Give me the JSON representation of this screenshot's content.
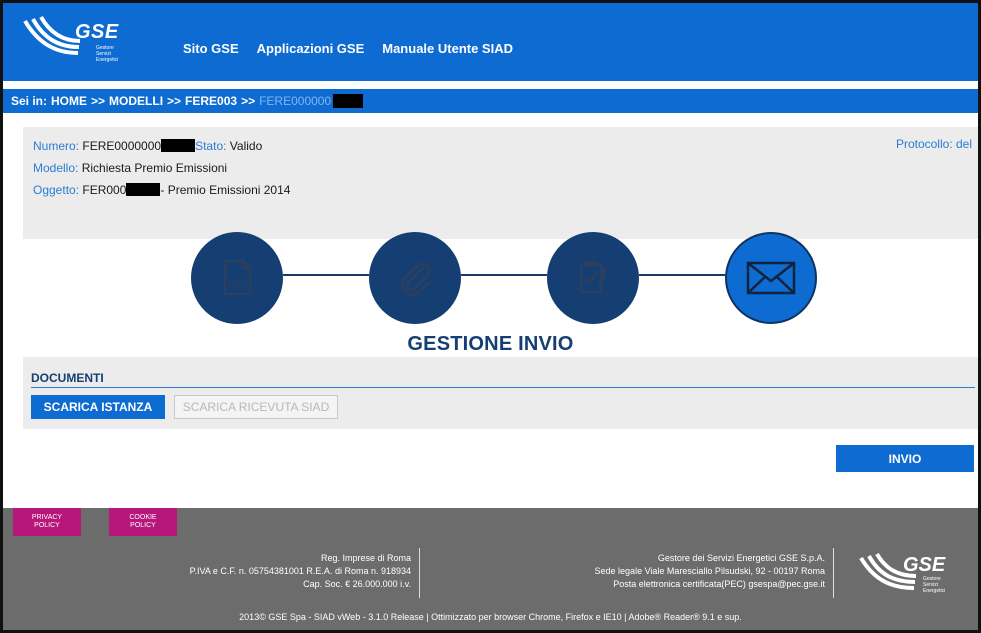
{
  "header": {
    "logo_text": "GSE",
    "logo_sub": [
      "Gestore",
      "Servizi",
      "Energetici"
    ],
    "nav": [
      "Sito GSE",
      "Applicazioni GSE",
      "Manuale Utente SIAD"
    ]
  },
  "breadcrumb": {
    "prefix": "Sei in:",
    "items": [
      "HOME",
      "MODELLI",
      "FERE003"
    ],
    "separator": ">>",
    "current": "FERE000000"
  },
  "info": {
    "numero_label": "Numero:",
    "numero_value": "FERE0000000",
    "stato_label": "Stato:",
    "stato_value": "Valido",
    "modello_label": "Modello:",
    "modello_value": "Richiesta Premio Emissioni",
    "oggetto_label": "Oggetto:",
    "oggetto_value_prefix": "FER000",
    "oggetto_value_suffix": "- Premio Emissioni 2014",
    "protocollo": "Protocollo: del"
  },
  "steps": [
    {
      "icon": "pdf-icon",
      "active": false
    },
    {
      "icon": "paperclip-icon",
      "active": false
    },
    {
      "icon": "clipboard-check-icon",
      "active": false
    },
    {
      "icon": "envelope-icon",
      "active": true
    }
  ],
  "section_title": "GESTIONE INVIO",
  "documents": {
    "title": "DOCUMENTI",
    "download_instance": "SCARICA ISTANZA",
    "download_receipt": "SCARICA RICEVUTA SIAD"
  },
  "send_button": "INVIO",
  "footer": {
    "privacy": [
      "PRIVACY",
      "POLICY"
    ],
    "cookie": [
      "COOKIE",
      "POLICY"
    ],
    "left": [
      "Reg. Imprese di Roma",
      "P.IVA e C.F. n. 05754381001 R.E.A. di Roma n. 918934",
      "Cap. Soc. € 26.000.000 i.v."
    ],
    "right": [
      "Gestore dei Servizi Energetici GSE S.p.A.",
      "Sede legale Viale Maresciallo Pilsudski, 92 - 00197 Roma",
      "Posta elettronica certificata(PEC) gsespa@pec.gse.it"
    ],
    "bottom": "2013© GSE Spa - SIAD vWeb - 3.1.0 Release | Ottimizzato per browser Chrome, Firefox e IE10 | Adobe® Reader® 9.1 e sup."
  },
  "colors": {
    "primary": "#0e6bd1",
    "dark_blue": "#153e72",
    "label_blue": "#2b7cd3",
    "panel_gray": "#ececec",
    "footer_gray": "#6c6c6c",
    "policy_magenta": "#b7177a"
  }
}
